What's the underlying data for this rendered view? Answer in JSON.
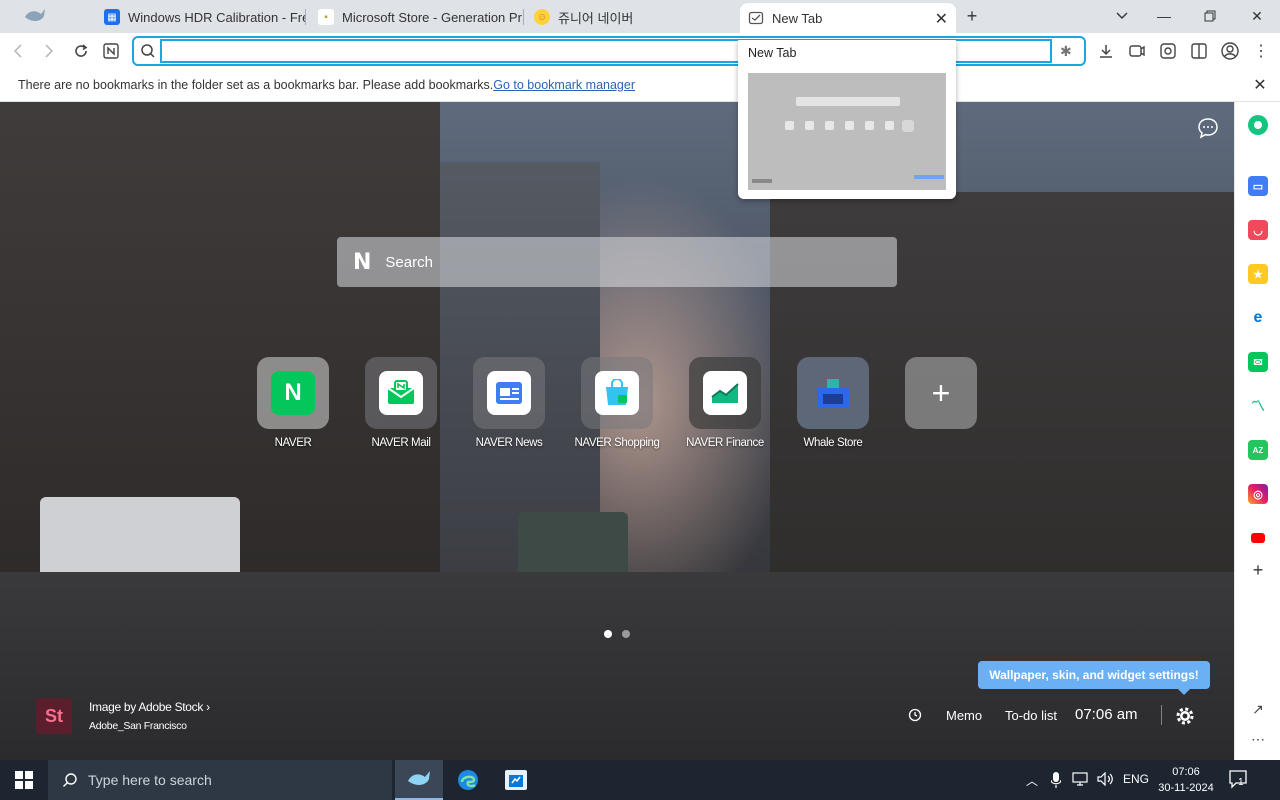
{
  "tabs": [
    {
      "label": "Windows HDR Calibration - Fre",
      "icon": "windows-store-icon"
    },
    {
      "label": "Microsoft Store - Generation Pr",
      "icon": "bing-icon"
    },
    {
      "label": "쥬니어 네이버",
      "icon": "junior-naver-icon"
    },
    {
      "label": "New Tab",
      "icon": "new-tab-icon"
    }
  ],
  "omnibox": {
    "value": "",
    "placeholder": ""
  },
  "bookmark_bar": {
    "message": "There are no bookmarks in the folder set as a bookmarks bar. Please add bookmarks.",
    "link": "Go to bookmark manager"
  },
  "hover_card": {
    "title": "New Tab"
  },
  "search": {
    "placeholder": "Search"
  },
  "shortcuts": [
    {
      "label": "NAVER",
      "color": "#03c75a"
    },
    {
      "label": "NAVER Mail",
      "color": "#03c75a"
    },
    {
      "label": "NAVER News",
      "color": "#3f7cf5"
    },
    {
      "label": "NAVER Shopping",
      "color": "#33c3f0"
    },
    {
      "label": "NAVER Finance",
      "color": "#10b981"
    },
    {
      "label": "Whale Store",
      "color": "#2d68e8"
    }
  ],
  "credit": {
    "title": "Image by Adobe Stock",
    "subtitle": "Adobe_San Francisco",
    "logo": "St"
  },
  "widgets": {
    "memo": "Memo",
    "todo": "To-do list",
    "time": "07:06 am"
  },
  "settings_tip": "Wallpaper, skin, and widget settings!",
  "taskbar": {
    "search_placeholder": "Type here to search",
    "lang": "ENG",
    "time": "07:06",
    "date": "30-11-2024",
    "notif_count": "1"
  },
  "colors": {
    "accent": "#1aa7e0",
    "tip": "#6bb0f4"
  }
}
